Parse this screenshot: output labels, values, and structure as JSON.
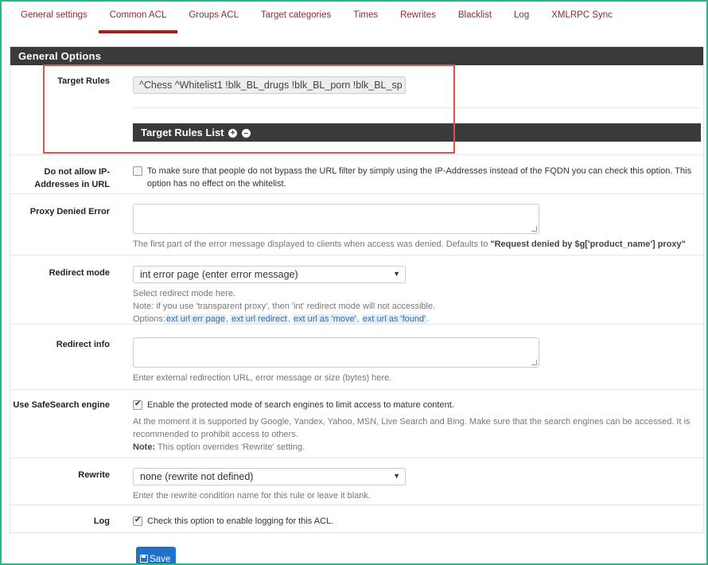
{
  "tabs": [
    {
      "label": "General settings"
    },
    {
      "label": "Common ACL"
    },
    {
      "label": "Groups ACL"
    },
    {
      "label": "Target categories"
    },
    {
      "label": "Times"
    },
    {
      "label": "Rewrites"
    },
    {
      "label": "Blacklist"
    },
    {
      "label": "Log"
    },
    {
      "label": "XMLRPC Sync"
    }
  ],
  "panel": {
    "title": "General Options"
  },
  "target_rules": {
    "label": "Target Rules",
    "value": "^Chess ^Whitelist1 !blk_BL_drugs !blk_BL_porn !blk_BL_sp",
    "list_title": "Target Rules List"
  },
  "ip_addresses": {
    "label": "Do not allow IP-Addresses in URL",
    "checked": false,
    "text": "To make sure that people do not bypass the URL filter by simply using the IP-Addresses instead of the FQDN you can check this option. This option has no effect on the whitelist."
  },
  "proxy_denied": {
    "label": "Proxy Denied Error",
    "value": "",
    "help_prefix": "The first part of the error message displayed to clients when access was denied. Defaults to ",
    "help_bold": "\"Request denied by $g['product_name'] proxy\""
  },
  "redirect_mode": {
    "label": "Redirect mode",
    "selected": "int error page (enter error message)",
    "help_line1": "Select redirect mode here.",
    "help_line2": "Note: if you use 'transparent proxy', then 'int' redirect mode will not accessible.",
    "options_prefix": "Options:",
    "options": [
      "ext url err page",
      "ext url redirect",
      "ext url as 'move'",
      "ext url as 'found'"
    ],
    "options_sep": ",",
    "options_end": "."
  },
  "redirect_info": {
    "label": "Redirect info",
    "value": "",
    "help": "Enter external redirection URL, error message or size (bytes) here."
  },
  "safesearch": {
    "label": "Use SafeSearch engine",
    "checked": true,
    "text": "Enable the protected mode of search engines to limit access to mature content.",
    "help": "At the moment it is supported by Google, Yandex, Yahoo, MSN, Live Search and Bing. Make sure that the search engines can be accessed. It is recommended to prohibit access to others.",
    "note_bold": "Note:",
    "note_text": " This option overrides 'Rewrite' setting."
  },
  "rewrite": {
    "label": "Rewrite",
    "selected": "none (rewrite not defined)",
    "help": "Enter the rewrite condition name for this rule or leave it blank."
  },
  "log": {
    "label": "Log",
    "checked": true,
    "text": "Check this option to enable logging for this ACL."
  },
  "save_button": {
    "label": "Save"
  },
  "colors": {
    "accent": "#a32020",
    "tab_text": "#8b2d2d",
    "panel_header": "#3a3a38",
    "highlight_box": "#e0514d",
    "frame": "#2eb48a",
    "save_button": "#1e73c8"
  }
}
